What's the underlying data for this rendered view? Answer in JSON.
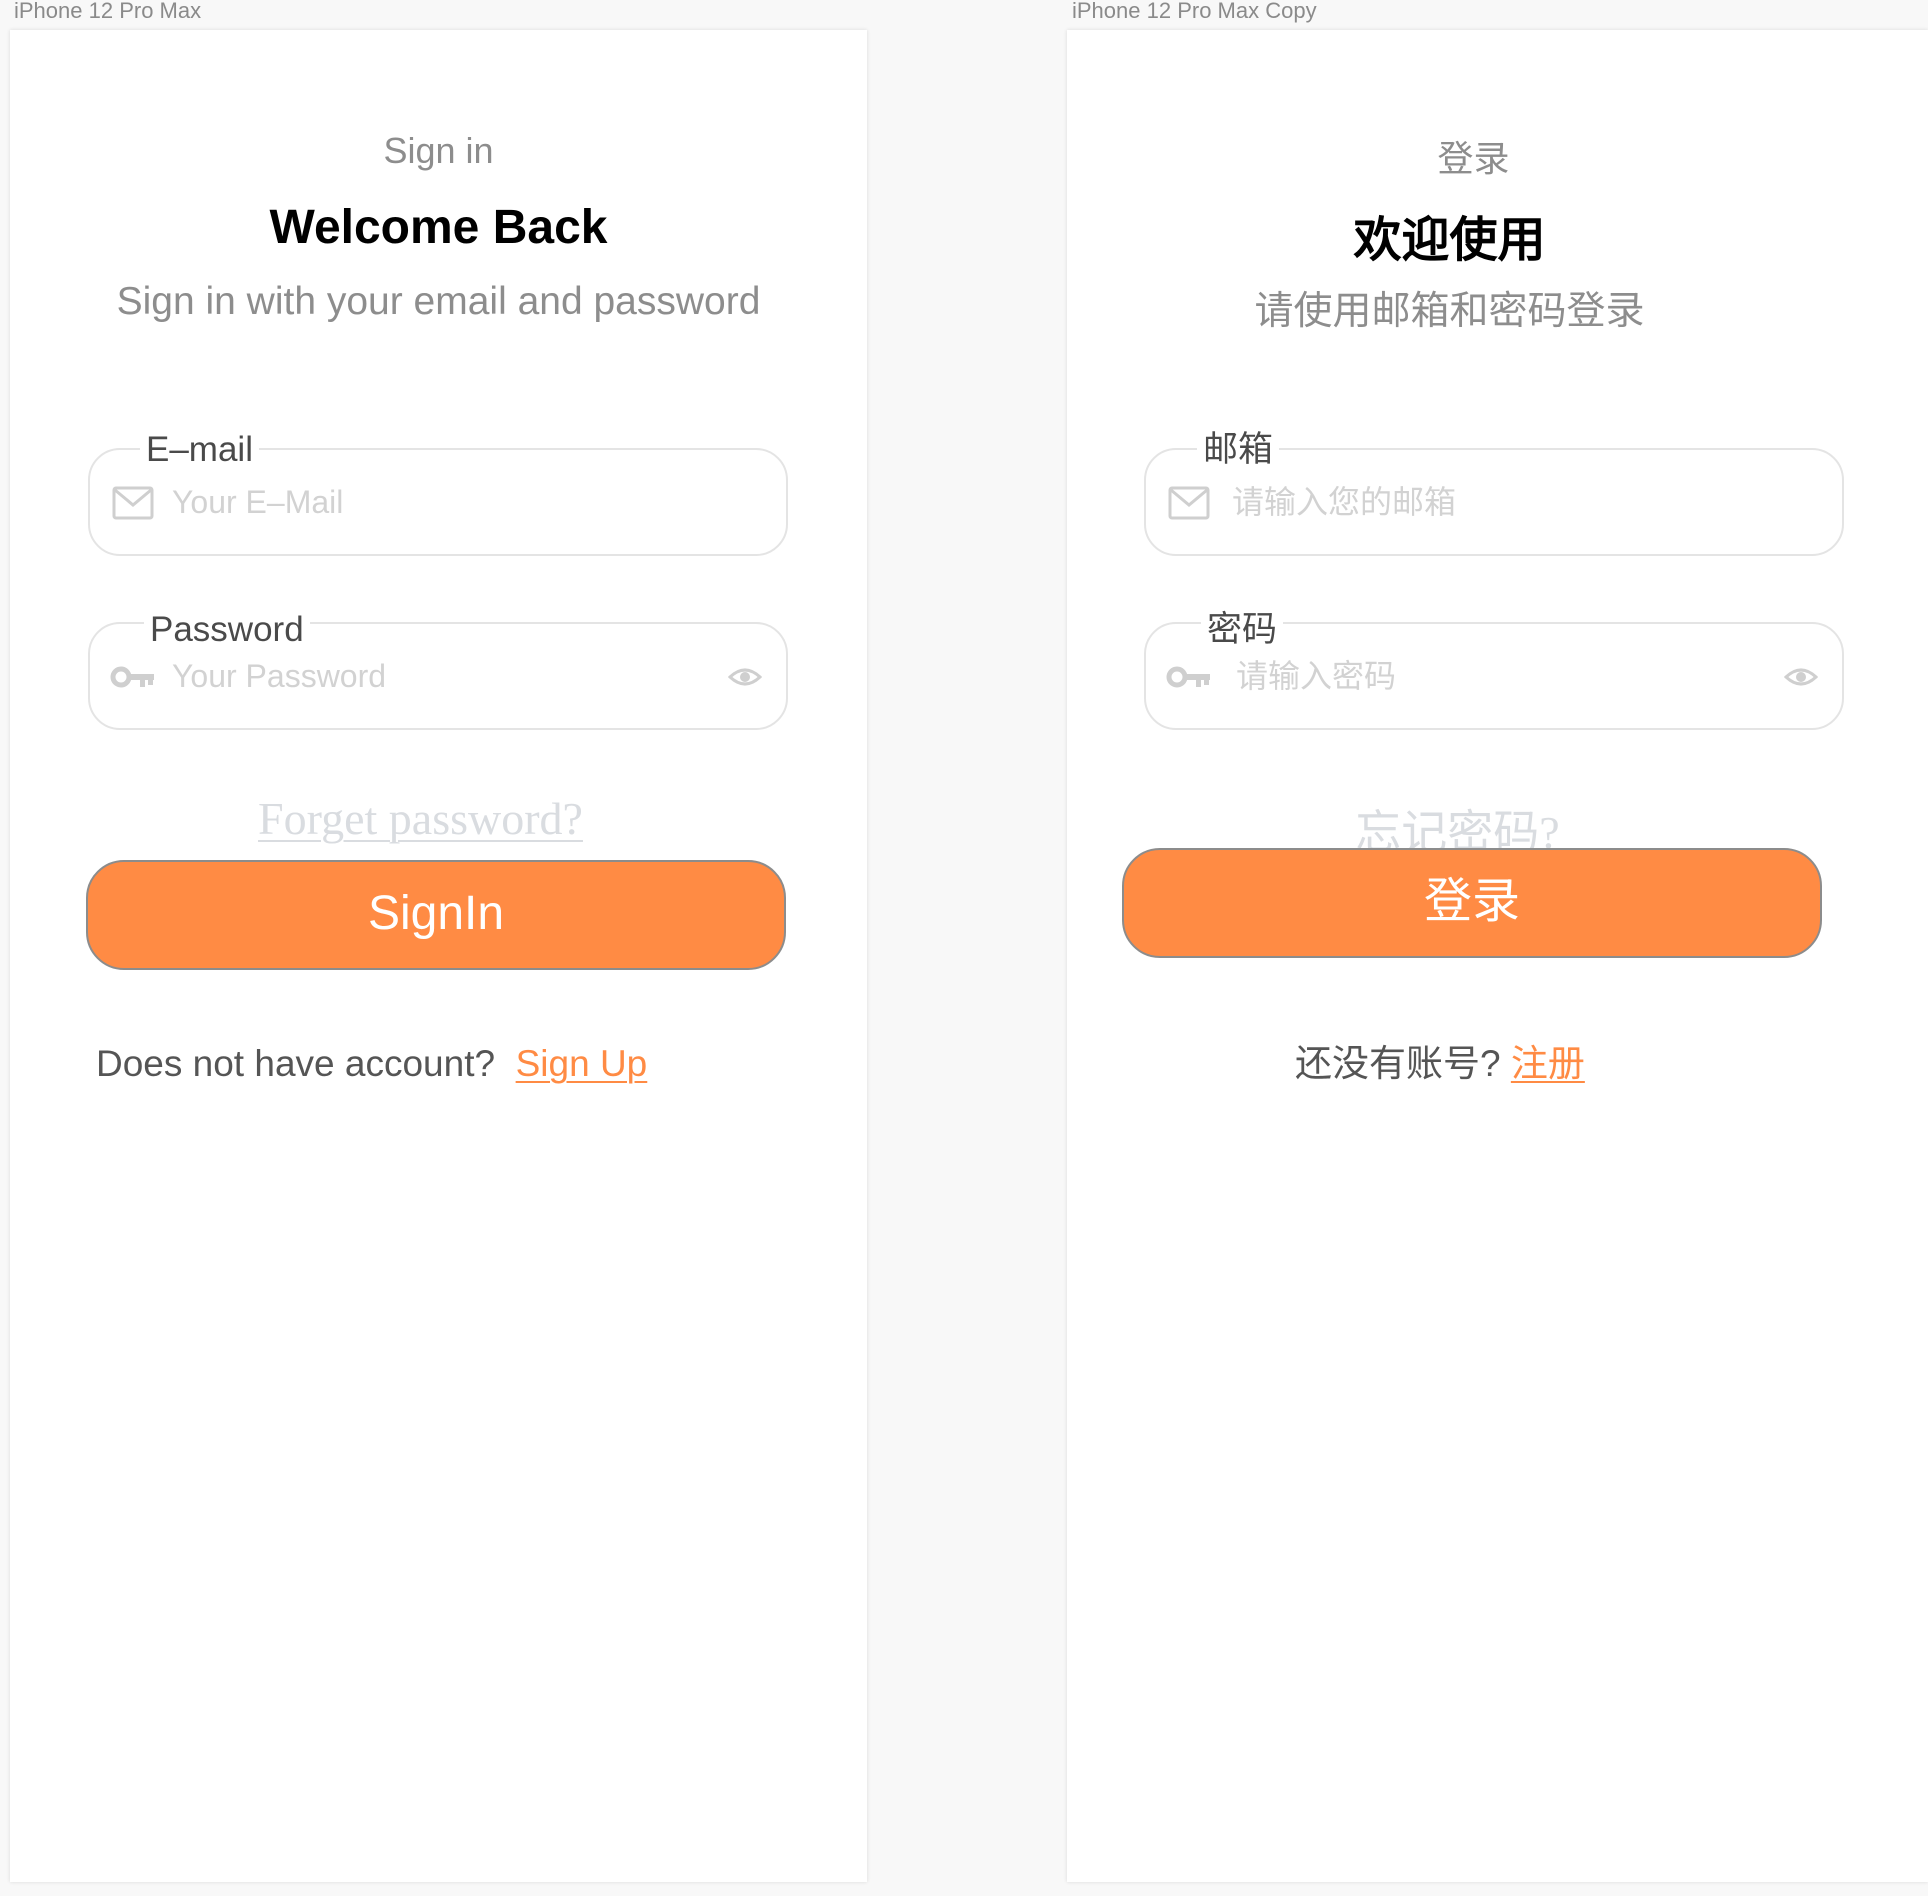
{
  "canvas": {
    "background": "#f8f8f8",
    "accent_color": "#ff8b44"
  },
  "frames": [
    {
      "frame_label": "iPhone 12 Pro Max",
      "kicker": "Sign in",
      "headline": "Welcome Back",
      "subline": "Sign in with your email and password",
      "email": {
        "label": "E–mail",
        "placeholder": "Your E–Mail",
        "icon": "mail-icon"
      },
      "password": {
        "label": "Password",
        "placeholder": "Your Password",
        "icon": "key-icon",
        "toggle_icon": "eye-icon"
      },
      "forgot_label": "Forget password?",
      "submit_label": "SignIn",
      "signup_prompt": "Does not have account?",
      "signup_link": "Sign Up"
    },
    {
      "frame_label": "iPhone 12 Pro Max Copy",
      "kicker": "登录",
      "headline": "欢迎使用",
      "subline": "请使用邮箱和密码登录",
      "email": {
        "label": "邮箱",
        "placeholder": "请输入您的邮箱",
        "icon": "mail-icon"
      },
      "password": {
        "label": "密码",
        "placeholder": "请输入密码",
        "icon": "key-icon",
        "toggle_icon": "eye-icon"
      },
      "forgot_label": "忘记密码?",
      "submit_label": "登录",
      "signup_prompt": "还没有账号?",
      "signup_link": "注册"
    }
  ]
}
